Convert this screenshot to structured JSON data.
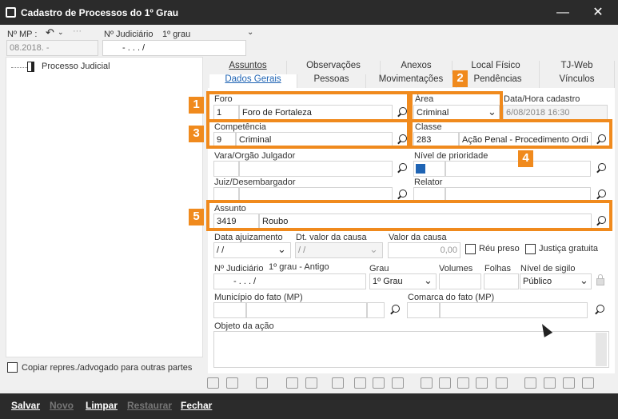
{
  "window": {
    "title": "Cadastro de Processos do 1º Grau"
  },
  "header": {
    "mp_label": "Nº MP :",
    "mp_value": "08.2018.        -",
    "judicial_label": "Nº Judiciário",
    "judicial_grade": "1º grau",
    "judicial_value": "-   .    .   .     /"
  },
  "tree": {
    "root_label": "Processo Judicial"
  },
  "copy_checkbox_label": "Copiar repres./advogado para outras partes",
  "tabs_row1": [
    "Assuntos",
    "Observações",
    "Anexos",
    "Local Físico",
    "TJ-Web"
  ],
  "tabs_row2": [
    "Dados Gerais",
    "Pessoas",
    "Movimentações",
    "Pendências",
    "Vínculos"
  ],
  "form": {
    "foro_label": "Foro",
    "foro_code": "1",
    "foro_name": "Foro de Fortaleza",
    "area_label": "Área",
    "area_value": "Criminal",
    "datahora_label": "Data/Hora cadastro",
    "datahora_value": "6/08/2018 16:30",
    "competencia_label": "Competência",
    "competencia_code": "9",
    "competencia_name": "Criminal",
    "classe_label": "Classe",
    "classe_code": "283",
    "classe_name": "Ação Penal - Procedimento Ordi",
    "vara_label": "Vara/Orgão Julgador",
    "prioridade_label": "Nível de prioridade",
    "juiz_label": "Juiz/Desembargador",
    "relator_label": "Relator",
    "assunto_label": "Assunto",
    "assunto_code": "3419",
    "assunto_name": "Roubo",
    "ajuizamento_label": "Data ajuizamento",
    "ajuizamento_value": " / /",
    "dtvalor_label": "Dt. valor da causa",
    "dtvalor_value": " / /",
    "valor_label": "Valor da causa",
    "valor_value": "0,00",
    "reu_preso_label": "Réu preso",
    "justica_gratuita_label": "Justiça gratuita",
    "njud_label": "Nº Judiciário",
    "njud_grade": "1º grau - Antigo",
    "njud_value": "-   .    .   .     /",
    "grau_label": "Grau",
    "grau_value": "1º Grau",
    "volumes_label": "Volumes",
    "folhas_label": "Folhas",
    "sigilo_label": "Nível de sigilo",
    "sigilo_value": "Público",
    "municipio_label": "Município do fato (MP)",
    "comarca_label": "Comarca do fato (MP)",
    "objeto_label": "Objeto da ação"
  },
  "callouts": [
    "1",
    "2",
    "3",
    "4",
    "5"
  ],
  "bottom": {
    "salvar": "Salvar",
    "novo": "Novo",
    "limpar": "Limpar",
    "restaurar": "Restaurar",
    "fechar": "Fechar"
  },
  "colors": {
    "highlight": "#f08a1d",
    "titlebar": "#2b2b2b",
    "tab_active": "#1f64b4"
  }
}
